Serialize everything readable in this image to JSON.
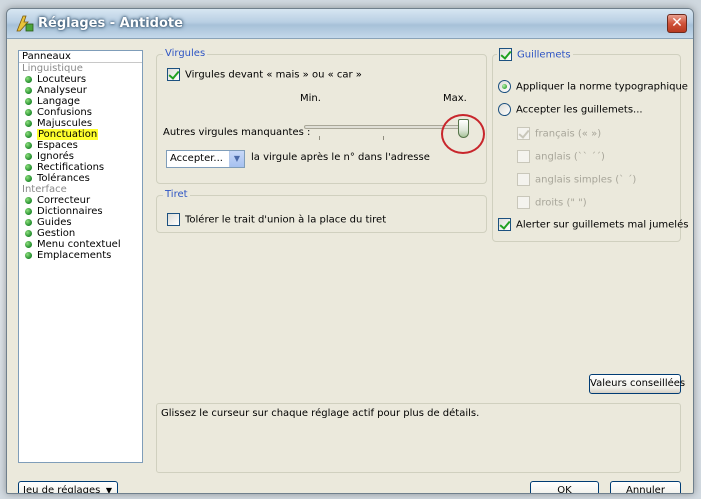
{
  "window": {
    "title": "Réglages - Antidote",
    "close_glyph": "✕"
  },
  "panels": {
    "header": "Panneaux",
    "linguistique_label": "Linguistique",
    "linguistique_items": [
      "Locuteurs",
      "Analyseur",
      "Langage",
      "Confusions",
      "Majuscules",
      "Ponctuation",
      "Espaces",
      "Ignorés",
      "Rectifications",
      "Tolérances"
    ],
    "selected": "Ponctuation",
    "interface_label": "Interface",
    "interface_items": [
      "Correcteur",
      "Dictionnaires",
      "Guides",
      "Gestion",
      "Menu contextuel",
      "Emplacements"
    ]
  },
  "virgules": {
    "legend": "Virgules",
    "checkbox_label": "Virgules devant « mais » ou « car »",
    "checkbox_checked": true,
    "slider_min_label": "Min.",
    "slider_max_label": "Max.",
    "slider_label": "Autres virgules manquantes :",
    "slider_level": 1.0,
    "dropdown_value": "Accepter...",
    "dropdown_suffix": "la virgule après le n° dans l'adresse"
  },
  "tiret": {
    "legend": "Tiret",
    "checkbox_label": "Tolérer le trait d'union à la place du tiret",
    "checkbox_checked": false
  },
  "guillemets": {
    "legend": "Guillemets",
    "legend_checked": true,
    "radio_norme": "Appliquer la norme typographique",
    "radio_accepter": "Accepter les guillemets...",
    "francais": "français (« »)",
    "anglais": "anglais (`` ´´)",
    "anglais_simples": "anglais simples (` ´)",
    "droits": "droits (\" \")",
    "alerter": "Alerter sur guillemets mal jumelés",
    "alerter_checked": true
  },
  "buttons": {
    "valeurs_conseillees": "Valeurs conseillées",
    "jeu_de_reglages": "Jeu de réglages",
    "ok": "OK",
    "annuler": "Annuler"
  },
  "info_text": "Glissez le curseur sur chaque réglage actif pour plus de détails.",
  "colors": {
    "legend_blue": "#2e55c4",
    "highlight_yellow": "#ffff2e",
    "annotation_red": "#c8262c"
  }
}
